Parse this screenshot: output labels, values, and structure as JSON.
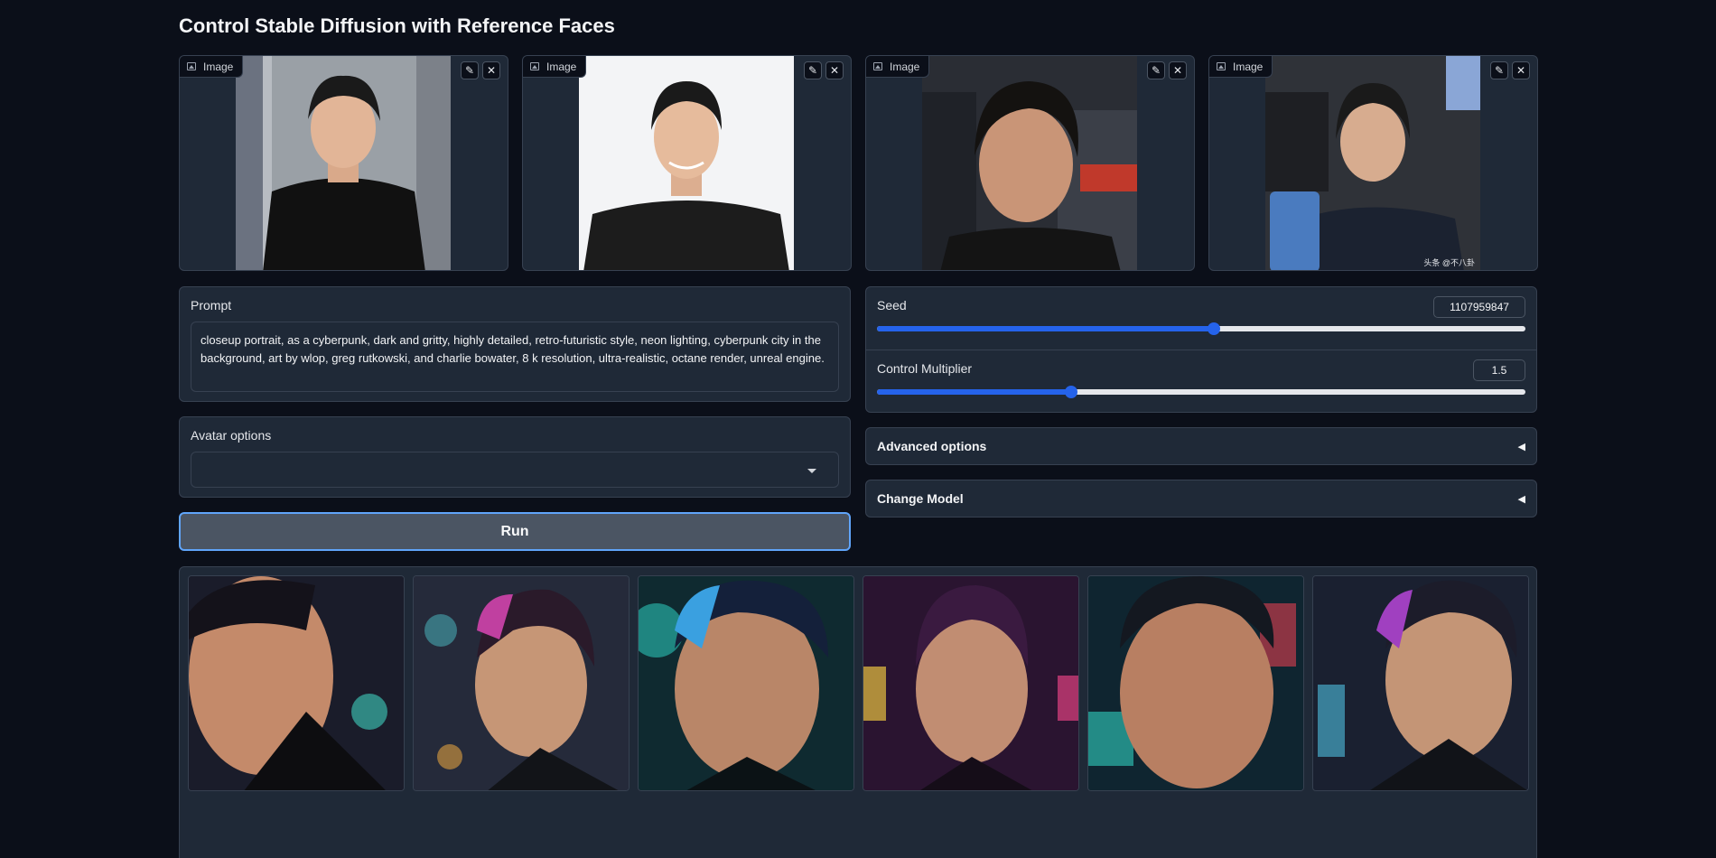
{
  "page": {
    "title": "Control Stable Diffusion with Reference Faces"
  },
  "reference_images": [
    {
      "label": "Image",
      "edit_icon": "pencil-icon",
      "close_icon": "close-icon",
      "watermark": ""
    },
    {
      "label": "Image",
      "edit_icon": "pencil-icon",
      "close_icon": "close-icon",
      "watermark": ""
    },
    {
      "label": "Image",
      "edit_icon": "pencil-icon",
      "close_icon": "close-icon",
      "watermark": ""
    },
    {
      "label": "Image",
      "edit_icon": "pencil-icon",
      "close_icon": "close-icon",
      "watermark": "头条 @不八卦"
    }
  ],
  "prompt": {
    "label": "Prompt",
    "value": "closeup portrait, as a cyberpunk, dark and gritty, highly detailed, retro-futuristic style, neon lighting, cyberpunk city in the background, art by wlop, greg rutkowski, and charlie bowater, 8 k resolution, ultra-realistic, octane render, unreal engine."
  },
  "avatar_options": {
    "label": "Avatar options",
    "selected": ""
  },
  "run_button": {
    "label": "Run"
  },
  "seed": {
    "label": "Seed",
    "value": "1107959847",
    "slider_fraction": 0.52
  },
  "control_multiplier": {
    "label": "Control Multiplier",
    "value": "1.5",
    "slider_fraction": 0.3
  },
  "advanced_options": {
    "label": "Advanced options",
    "arrow": "◀"
  },
  "change_model": {
    "label": "Change Model",
    "arrow": "◀"
  },
  "colors": {
    "background": "#0b0f19",
    "panel": "#1f2937",
    "border": "#374151",
    "accent": "#2563eb",
    "run_focus": "#60a5fa"
  }
}
